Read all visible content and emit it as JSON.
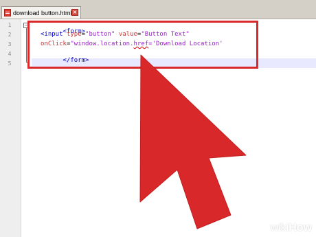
{
  "tab": {
    "label": "download button.html",
    "close_glyph": "×"
  },
  "line_numbers": [
    "1",
    "2",
    "3",
    "4",
    "5"
  ],
  "fold_glyph": "−",
  "code": {
    "line1": {
      "tag": "<form>"
    },
    "line2": {
      "open": "<input ",
      "attr1": "type",
      "eq1": "=",
      "val1": "\"button\"",
      "sp": " ",
      "attr2": "value",
      "eq2": "=",
      "val2": "\"Button Text\""
    },
    "line3": {
      "attr": "onClick",
      "eq": "=",
      "val_a": "\"window.location.",
      "val_err": "href",
      "val_b": "='Download Location'"
    },
    "line4": {
      "tag": "</form>"
    }
  },
  "watermark": {
    "wiki": "wiki",
    "how": "How"
  },
  "colors": {
    "highlight": "#d8282a",
    "arrow": "#d8282a",
    "tag": "#0000cc",
    "attribute": "#cc3333",
    "string": "#9b1ec9"
  },
  "icons": {
    "file": "html-file-icon",
    "close": "close-icon",
    "fold": "fold-collapse-icon",
    "pointer": "arrow-cursor-icon"
  }
}
